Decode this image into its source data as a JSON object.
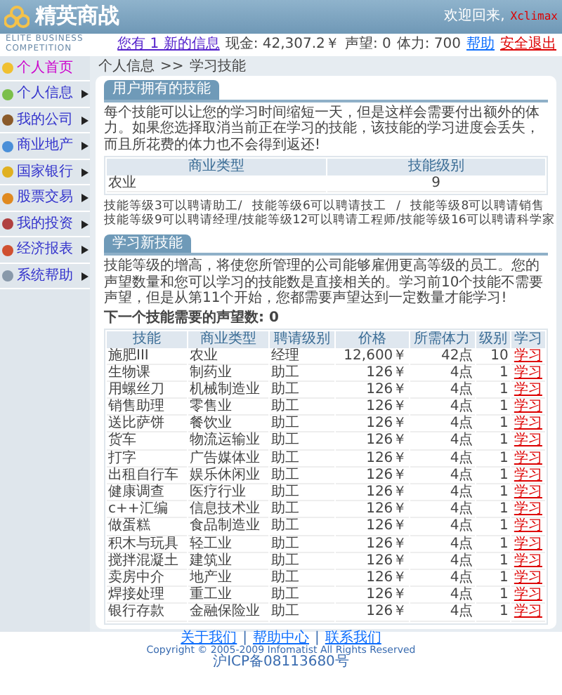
{
  "header": {
    "logo": "精英商战",
    "tagline": "ELITE BUSINESS COMPETITION",
    "welcome": "欢迎回来,",
    "user": "Xclimax",
    "messages": "您有 1 新的信息",
    "stats": [
      "现金: 42,307.2￥",
      "声望: 0",
      "体力: 700"
    ],
    "help": "帮助",
    "logout": "安全退出"
  },
  "sidebar": {
    "items": [
      {
        "label": "个人首页",
        "selected": true,
        "has_submenu": false
      },
      {
        "label": "个人信息",
        "selected": false,
        "has_submenu": true
      },
      {
        "label": "我的公司",
        "selected": false,
        "has_submenu": true
      },
      {
        "label": "商业地产",
        "selected": false,
        "has_submenu": true
      },
      {
        "label": "国家银行",
        "selected": false,
        "has_submenu": true
      },
      {
        "label": "股票交易",
        "selected": false,
        "has_submenu": true
      },
      {
        "label": "我的投资",
        "selected": false,
        "has_submenu": true
      },
      {
        "label": "经济报表",
        "selected": false,
        "has_submenu": true
      },
      {
        "label": "系统帮助",
        "selected": false,
        "has_submenu": true
      }
    ]
  },
  "breadcrumb": {
    "items": [
      "个人信息",
      "学习技能"
    ],
    "separator": ">>"
  },
  "owned_skills": {
    "title": "用户拥有的技能",
    "intro": "每个技能可以让您的学习时间缩短一天，但是这样会需要付出额外的体力。如果您选择取消当前正在学习的技能，该技能的学习进度会丢失，而且所花费的体力也不会得到返还!",
    "columns": [
      "商业类型",
      "技能级别"
    ],
    "rows": [
      [
        "农业",
        "9"
      ]
    ],
    "separator": "/",
    "rules": [
      [
        "技能等级3可以聘请助工",
        "技能等级6可以聘请技工",
        "技能等级8可以聘请销售"
      ],
      [
        "技能等级9可以聘请经理",
        "技能等级12可以聘请工程师",
        "技能等级16可以聘请科学家"
      ]
    ]
  },
  "learn": {
    "title": "学习新技能",
    "intro": "技能等级的增高，将使您所管理的公司能够雇佣更高等级的员工。您的声望数量和您可以学习的技能数是直接相关的。学习前10个技能不需要声望，但是从第11个开始，您都需要声望达到一定数量才能学习!",
    "next_reputation": "下一个技能需要的声望数: 0",
    "columns": [
      "技能",
      "商业类型",
      "聘请级别",
      "价格",
      "所需体力",
      "级别",
      "学习"
    ],
    "rows": [
      [
        "施肥III",
        "农业",
        "经理",
        "12,600￥",
        "42点",
        "10",
        "学习"
      ],
      [
        "生物课",
        "制药业",
        "助工",
        "126￥",
        "4点",
        "1",
        "学习"
      ],
      [
        "用螺丝刀",
        "机械制造业",
        "助工",
        "126￥",
        "4点",
        "1",
        "学习"
      ],
      [
        "销售助理",
        "零售业",
        "助工",
        "126￥",
        "4点",
        "1",
        "学习"
      ],
      [
        "送比萨饼",
        "餐饮业",
        "助工",
        "126￥",
        "4点",
        "1",
        "学习"
      ],
      [
        "货车",
        "物流运输业",
        "助工",
        "126￥",
        "4点",
        "1",
        "学习"
      ],
      [
        "打字",
        "广告媒体业",
        "助工",
        "126￥",
        "4点",
        "1",
        "学习"
      ],
      [
        "出租自行车",
        "娱乐休闲业",
        "助工",
        "126￥",
        "4点",
        "1",
        "学习"
      ],
      [
        "健康调查",
        "医疗行业",
        "助工",
        "126￥",
        "4点",
        "1",
        "学习"
      ],
      [
        "c++汇编",
        "信息技术业",
        "助工",
        "126￥",
        "4点",
        "1",
        "学习"
      ],
      [
        "做蛋糕",
        "食品制造业",
        "助工",
        "126￥",
        "4点",
        "1",
        "学习"
      ],
      [
        "积木与玩具",
        "轻工业",
        "助工",
        "126￥",
        "4点",
        "1",
        "学习"
      ],
      [
        "搅拌混凝土",
        "建筑业",
        "助工",
        "126￥",
        "4点",
        "1",
        "学习"
      ],
      [
        "卖房中介",
        "地产业",
        "助工",
        "126￥",
        "4点",
        "1",
        "学习"
      ],
      [
        "焊接处理",
        "重工业",
        "助工",
        "126￥",
        "4点",
        "1",
        "学习"
      ],
      [
        "银行存款",
        "金融保险业",
        "助工",
        "126￥",
        "4点",
        "1",
        "学习"
      ]
    ]
  },
  "footer": {
    "links": [
      "关于我们",
      "帮助中心",
      "联系我们"
    ],
    "separator": "|",
    "copyright": "Copyright © 2005-2009 Infomatist All Rights Reserved",
    "icp": "沪ICP备08113680号"
  }
}
